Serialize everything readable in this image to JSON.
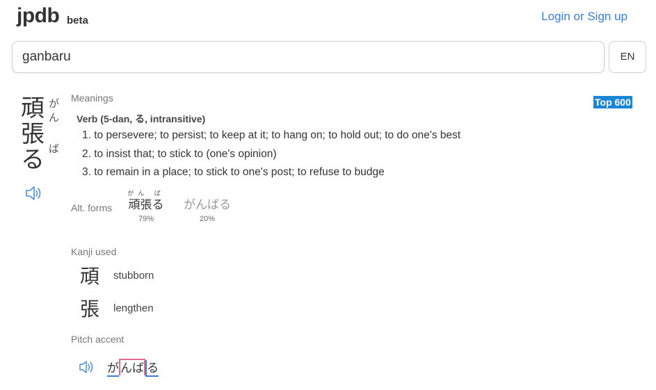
{
  "header": {
    "logo": "jpdb",
    "beta": "beta",
    "login": "Login or Sign up"
  },
  "search": {
    "value": "ganbaru",
    "lang_button": "EN"
  },
  "word": {
    "kanji": [
      "頑",
      "張",
      "る"
    ],
    "furigana_top": [
      "が",
      "ん"
    ],
    "furigana_bottom": [
      "ば"
    ],
    "audio_icon": "speaker-icon"
  },
  "badge": "Top 600",
  "meanings_section": {
    "label": "Meanings",
    "part_of_speech": "Verb (5-dan, る, intransitive)",
    "items": [
      "1. to persevere; to persist; to keep at it; to hang on; to hold out; to do one's best",
      "2. to insist that; to stick to (one's opinion)",
      "3. to remain in a place; to stick to one's post; to refuse to budge"
    ]
  },
  "alt_forms": {
    "label": "Alt. forms",
    "forms": [
      {
        "furigana": "がん ば",
        "word": "頑張る",
        "percent": "79%"
      },
      {
        "word": "がんばる",
        "percent": "20%"
      }
    ]
  },
  "kanji_used": {
    "label": "Kanji used",
    "items": [
      {
        "kanji": "頑",
        "meaning": "stubborn"
      },
      {
        "kanji": "張",
        "meaning": "lengthen"
      }
    ]
  },
  "pitch_accent": {
    "label": "Pitch accent",
    "mora": [
      "が",
      "んば",
      "る"
    ],
    "colors": {
      "low": "#3b7dd8",
      "high": "#e06b8e"
    }
  },
  "colors": {
    "link": "#3b7dd8",
    "badge": "#1b86d4"
  }
}
